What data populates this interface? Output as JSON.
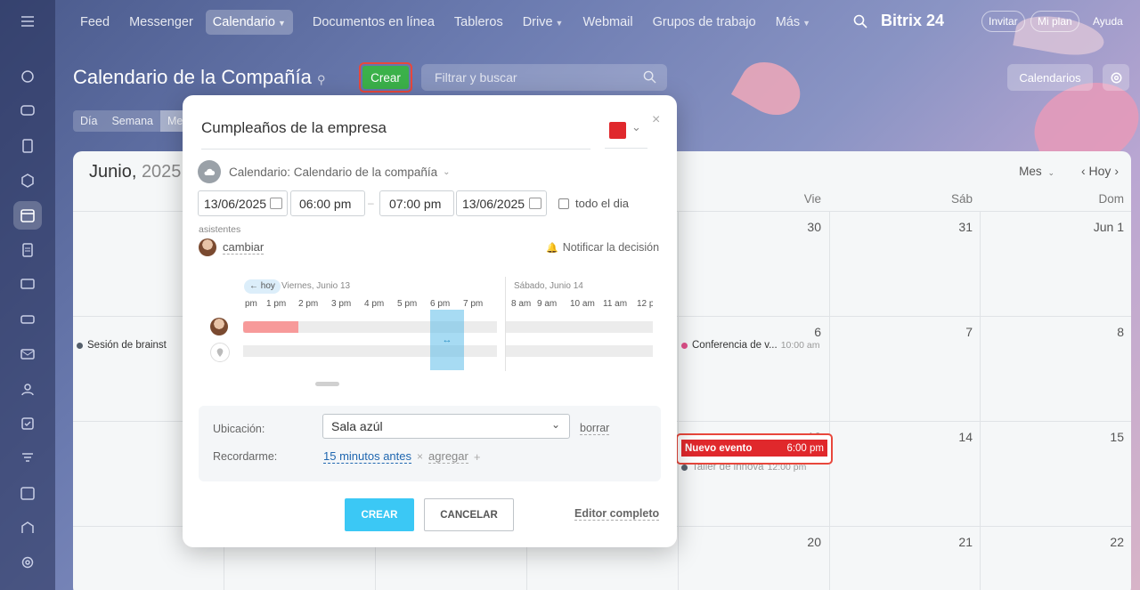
{
  "nav": {
    "items": [
      "Feed",
      "Messenger",
      "Calendario",
      "Documentos en línea",
      "Tableros",
      "Drive",
      "Webmail",
      "Grupos de trabajo",
      "Más"
    ],
    "logo": "Bitrix 24",
    "invitar": "Invitar",
    "mi_plan": "Mi plan",
    "ayuda": "Ayuda"
  },
  "header": {
    "title": "Calendario de la Compañía",
    "create_label": "Crear",
    "search_placeholder": "Filtrar y buscar",
    "calendarios_label": "Calendarios",
    "views": [
      "Día",
      "Semana",
      "Me"
    ]
  },
  "calendar": {
    "month": "Junio,",
    "year": "2025",
    "view_select": "Mes",
    "today_label": "Hoy",
    "weekdays": [
      "Vie",
      "Sáb",
      "Dom"
    ],
    "week1": [
      "30",
      "31",
      "Jun 1"
    ],
    "week2": [
      "6",
      "7",
      "8"
    ],
    "week3": [
      "13",
      "14",
      "15"
    ],
    "week4": [
      "20",
      "21",
      "22"
    ],
    "events": {
      "sesion": "Sesión de brainst",
      "conferencia": "Conferencia de v...",
      "conferencia_time": "10:00 am",
      "taller": "Taller de innova",
      "taller_time": "12:00 pm"
    },
    "new_event": {
      "title": "Nuevo evento",
      "time": "6:00 pm"
    }
  },
  "dialog": {
    "event_title": "Cumpleaños de la empresa",
    "calendar_line": "Calendario: Calendario de la compañía",
    "start_date": "13/06/2025",
    "start_time": "06:00 pm",
    "end_time": "07:00 pm",
    "end_date": "13/06/2025",
    "all_day": "todo el dia",
    "attendees_label": "asistentes",
    "change_label": "cambiar",
    "notify_label": "Notificar la decisión",
    "planner": {
      "today_chip": "← hoy",
      "day1": "Viernes, Junio 13",
      "day2": "Sábado, Junio 14",
      "hours1": [
        "pm",
        "1 pm",
        "2 pm",
        "3 pm",
        "4 pm",
        "5 pm",
        "6 pm",
        "7 pm"
      ],
      "hours2": [
        "8 am",
        "9 am",
        "10 am",
        "11 am",
        "12 p"
      ]
    },
    "location_label": "Ubicación:",
    "location_value": "Sala azúl",
    "clear_label": "borrar",
    "reminder_label": "Recordarme:",
    "reminder_value": "15 minutos antes",
    "add_label": "agregar",
    "create_btn": "CREAR",
    "cancel_btn": "CANCELAR",
    "full_editor": "Editor completo"
  },
  "colors": {
    "accent_green": "#3bb14a",
    "event_red": "#e0282c",
    "highlight_border": "#e8473c",
    "create_blue": "#3bc8f5"
  }
}
